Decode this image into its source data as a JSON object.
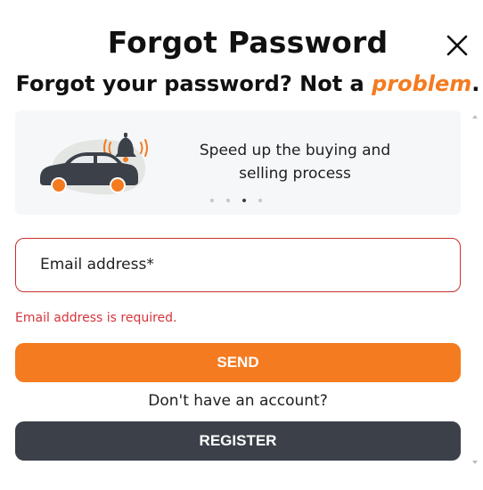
{
  "modal": {
    "title": "Forgot Password",
    "subtitle_prefix": "Forgot your password? Not a ",
    "subtitle_accent": "problem",
    "subtitle_suffix": "."
  },
  "carousel": {
    "line1": "Speed up the buying and",
    "line2": "selling process",
    "slide_count": 4,
    "active_slide": 3
  },
  "form": {
    "email_placeholder": "Email address*",
    "email_value": "",
    "email_error": "Email address is required.",
    "send_label": "SEND",
    "no_account_text": "Don't have an account?",
    "register_label": "REGISTER"
  },
  "colors": {
    "accent": "#f47b20",
    "dark": "#3b4049",
    "error": "#d7343a"
  },
  "icons": [
    "close-icon",
    "car-illustration",
    "bell-icon",
    "scroll-up-arrow",
    "scroll-down-arrow"
  ]
}
